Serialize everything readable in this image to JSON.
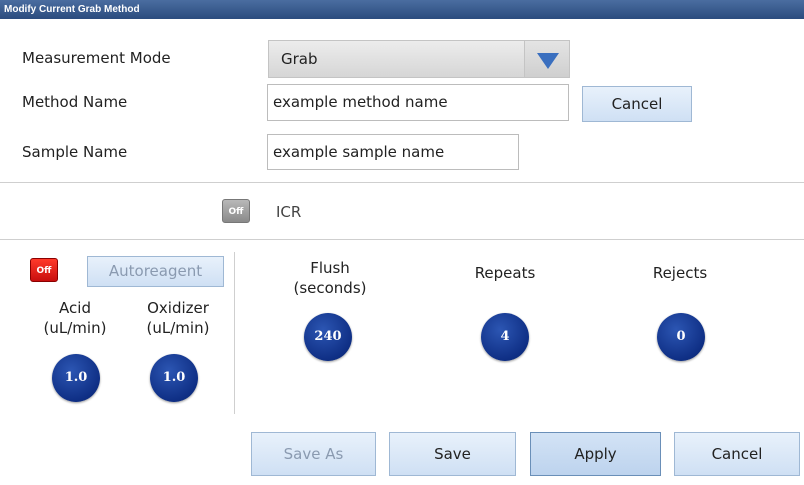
{
  "window": {
    "title": "Modify Current Grab Method"
  },
  "measurement_mode": {
    "label": "Measurement Mode",
    "value": "Grab",
    "icon": "dropdown-arrow-icon",
    "arrow_color": "#3a6fbf"
  },
  "method_name": {
    "label": "Method Name",
    "value": "example method name",
    "cancel_label": "Cancel"
  },
  "sample_name": {
    "label": "Sample Name",
    "value": "example sample name"
  },
  "icr": {
    "toggle_text": "Off",
    "label": "ICR"
  },
  "autoreagent": {
    "toggle_text": "Off",
    "button_label": "Autoreagent"
  },
  "acid": {
    "label_line1": "Acid",
    "label_line2": "(uL/min)",
    "value": "1.0"
  },
  "oxidizer": {
    "label_line1": "Oxidizer",
    "label_line2": "(uL/min)",
    "value": "1.0"
  },
  "flush": {
    "label_line1": "Flush",
    "label_line2": "(seconds)",
    "value": "240"
  },
  "repeats": {
    "label": "Repeats",
    "value": "4"
  },
  "rejects": {
    "label": "Rejects",
    "value": "0"
  },
  "footer": {
    "save_as_label": "Save As",
    "save_label": "Save",
    "apply_label": "Apply",
    "cancel_label": "Cancel"
  },
  "colors": {
    "title_bar": "#2b4c7e",
    "knob": "#0f2f85",
    "toggle_off_red": "#d81a10",
    "button": "#d6e5f6"
  }
}
